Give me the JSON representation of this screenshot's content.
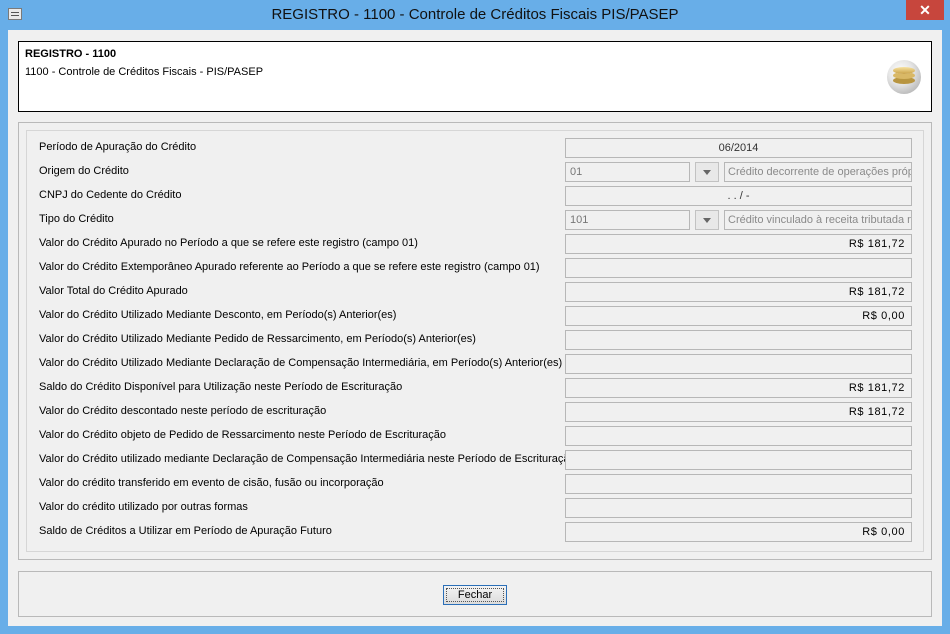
{
  "window": {
    "title": "REGISTRO - 1100 - Controle de Créditos Fiscais  PIS/PASEP",
    "close_glyph": "✕"
  },
  "header": {
    "title": "REGISTRO - 1100",
    "subtitle": "1100 - Controle de Créditos Fiscais - PIS/PASEP"
  },
  "form": {
    "periodo": {
      "label": "Período de Apuração do Crédito",
      "value": "06/2014"
    },
    "origem": {
      "label": "Origem do Crédito",
      "code": "01",
      "description": "Crédito decorrente de operações próprias"
    },
    "cnpj": {
      "label": "CNPJ do Cedente do Crédito",
      "value": ". .  /  -"
    },
    "tipo": {
      "label": "Tipo do Crédito",
      "code": "101",
      "description": "Crédito vinculado à receita tributada no mercado interno"
    },
    "rows": [
      {
        "label": "Valor do Crédito Apurado no Período a que se refere este registro (campo 01)",
        "value": "R$ 181,72"
      },
      {
        "label": "Valor do Crédito Extemporâneo Apurado referente ao Período a que se refere este registro (campo 01)",
        "value": ""
      },
      {
        "label": "Valor Total do Crédito Apurado",
        "value": "R$ 181,72"
      },
      {
        "label": "Valor do Crédito Utilizado Mediante Desconto, em Período(s) Anterior(es)",
        "value": "R$ 0,00"
      },
      {
        "label": "Valor do Crédito Utilizado Mediante Pedido de Ressarcimento, em Período(s) Anterior(es)",
        "value": ""
      },
      {
        "label": "Valor do Crédito Utilizado Mediante Declaração de Compensação Intermediária, em Período(s) Anterior(es)",
        "value": ""
      },
      {
        "label": "Saldo do Crédito Disponível para Utilização neste Período de Escrituração",
        "value": "R$ 181,72"
      },
      {
        "label": "Valor do Crédito descontado neste período de escrituração",
        "value": "R$ 181,72"
      },
      {
        "label": "Valor do Crédito objeto de Pedido de Ressarcimento neste Período de Escrituração",
        "value": ""
      },
      {
        "label": "Valor do Crédito utilizado mediante Declaração de Compensação Intermediária neste Período de Escrituração",
        "value": ""
      },
      {
        "label": "Valor do crédito transferido em evento de cisão, fusão ou incorporação",
        "value": ""
      },
      {
        "label": "Valor do crédito utilizado por outras formas",
        "value": ""
      },
      {
        "label": "Saldo de Créditos a Utilizar em Período de Apuração Futuro",
        "value": "R$ 0,00"
      }
    ]
  },
  "footer": {
    "close_label": "Fechar"
  }
}
